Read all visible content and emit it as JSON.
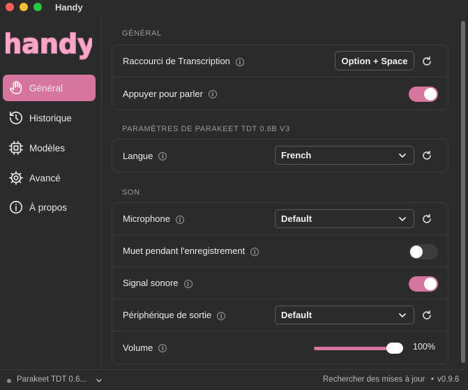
{
  "window": {
    "title": "Handy"
  },
  "sidebar": {
    "logo_text": "handy",
    "items": [
      {
        "label": "Général",
        "icon": "hand-icon",
        "active": true
      },
      {
        "label": "Historique",
        "icon": "history-icon",
        "active": false
      },
      {
        "label": "Modèles",
        "icon": "cpu-icon",
        "active": false
      },
      {
        "label": "Avancé",
        "icon": "gear-icon",
        "active": false
      },
      {
        "label": "À propos",
        "icon": "info-icon",
        "active": false
      }
    ]
  },
  "sections": {
    "general": {
      "label": "GÉNÉRAL",
      "shortcut_label": "Raccourci de Transcription",
      "shortcut_value": "Option + Space",
      "push_to_talk_label": "Appuyer pour parler",
      "push_to_talk_on": true
    },
    "model": {
      "label": "PARAMÈTRES DE PARAKEET TDT 0.6B V3",
      "language_label": "Langue",
      "language_value": "French"
    },
    "sound": {
      "label": "SON",
      "microphone_label": "Microphone",
      "microphone_value": "Default",
      "mute_label": "Muet pendant l'enregistrement",
      "mute_on": false,
      "signal_label": "Signal sonore",
      "signal_on": true,
      "output_label": "Périphérique de sortie",
      "output_value": "Default",
      "volume_label": "Volume",
      "volume_value": "100%",
      "volume_fraction": 1.0
    }
  },
  "footer": {
    "model": "Parakeet TDT 0.6...",
    "update": "Rechercher des mises à jour",
    "separator": "•",
    "version": "v0.9.6"
  },
  "colors": {
    "accent": "#d6769f",
    "background": "#2b2b2b"
  }
}
